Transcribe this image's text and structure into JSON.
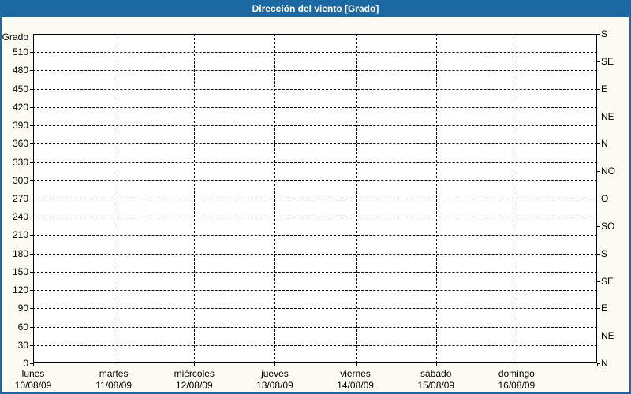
{
  "window": {
    "title": "Dirección del viento [Grado]"
  },
  "colors": {
    "accent_blue": "#1b68a3",
    "title_text": "#ffffff",
    "page_bg": "#fcfcf2",
    "plot_bg": "#ffffff",
    "grid": "#000000",
    "text": "#000000"
  },
  "chart_data": {
    "type": "line",
    "title": "Dirección del viento [Grado]",
    "ylabel": "Grado",
    "ylim": [
      0,
      540
    ],
    "grid": "dashed",
    "legend": "none",
    "series": [],
    "y_ticks_left": [
      0,
      30,
      60,
      90,
      120,
      150,
      180,
      210,
      240,
      270,
      300,
      330,
      360,
      390,
      420,
      450,
      480,
      510
    ],
    "right_axis_ticks": [
      {
        "deg": 0,
        "label": "N"
      },
      {
        "deg": 45,
        "label": "NE"
      },
      {
        "deg": 90,
        "label": "E"
      },
      {
        "deg": 135,
        "label": "SE"
      },
      {
        "deg": 180,
        "label": "S"
      },
      {
        "deg": 225,
        "label": "SO"
      },
      {
        "deg": 270,
        "label": "O"
      },
      {
        "deg": 315,
        "label": "NO"
      },
      {
        "deg": 360,
        "label": "N"
      },
      {
        "deg": 405,
        "label": "NE"
      },
      {
        "deg": 450,
        "label": "E"
      },
      {
        "deg": 495,
        "label": "SE"
      },
      {
        "deg": 540,
        "label": "S"
      }
    ],
    "x_days": [
      {
        "name": "lunes",
        "date": "10/08/09"
      },
      {
        "name": "martes",
        "date": "11/08/09"
      },
      {
        "name": "miércoles",
        "date": "12/08/09"
      },
      {
        "name": "jueves",
        "date": "13/08/09"
      },
      {
        "name": "viernes",
        "date": "14/08/09"
      },
      {
        "name": "sábado",
        "date": "15/08/09"
      },
      {
        "name": "domingo",
        "date": "16/08/09"
      }
    ]
  }
}
